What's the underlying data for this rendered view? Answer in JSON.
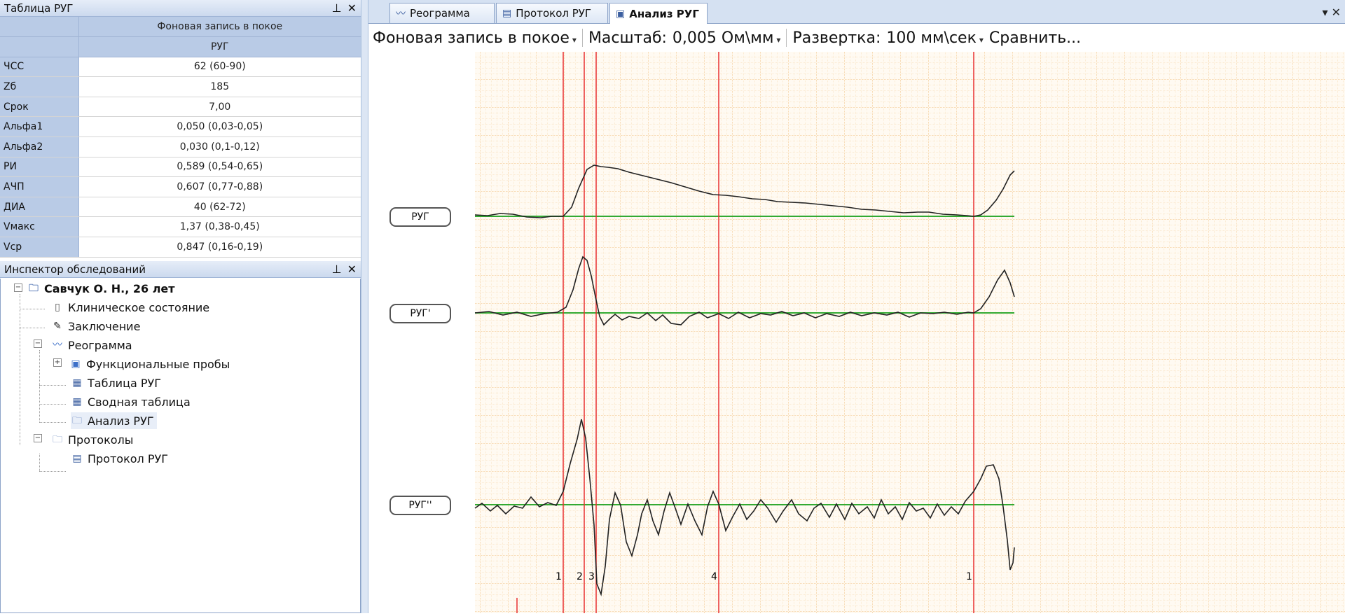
{
  "table_panel": {
    "title": "Таблица РУГ",
    "header_top": "Фоновая запись в покое",
    "header_sub": "РУГ",
    "rows": [
      {
        "label": "ЧСС",
        "value": "62 (60-90)"
      },
      {
        "label": "Zб",
        "value": "185"
      },
      {
        "label": "Срок",
        "value": "7,00"
      },
      {
        "label": "Альфа1",
        "value": "0,050 (0,03-0,05)"
      },
      {
        "label": "Альфа2",
        "value": "0,030 (0,1-0,12)"
      },
      {
        "label": "РИ",
        "value": "0,589 (0,54-0,65)"
      },
      {
        "label": "АЧП",
        "value": "0,607 (0,77-0,88)"
      },
      {
        "label": "ДИА",
        "value": "40 (62-72)"
      },
      {
        "label": "Vмакс",
        "value": "1,37 (0,38-0,45)"
      },
      {
        "label": "Vср",
        "value": "0,847 (0,16-0,19)"
      }
    ]
  },
  "inspector": {
    "title": "Инспектор обследований",
    "patient": "Савчук О. Н., 26 лет",
    "clinical": "Клиническое состояние",
    "conclusion": "Заключение",
    "reogram": "Реограмма",
    "func_tests": "Функциональные пробы",
    "table_rug": "Таблица РУГ",
    "summary": "Сводная таблица",
    "analysis": "Анализ РУГ",
    "protocols": "Протоколы",
    "protocol_rug": "Протокол РУГ"
  },
  "tabs": [
    {
      "label": "Реограмма"
    },
    {
      "label": "Протокол РУГ"
    },
    {
      "label": "Анализ РУГ"
    }
  ],
  "toolbar": {
    "record": "Фоновая запись в покое",
    "scale_label": "Масштаб:",
    "scale_value": "0,005 Ом\\мм",
    "sweep_label": "Развертка:",
    "sweep_value": "100 мм\\сек",
    "compare": "Сравнить..."
  },
  "channels": [
    {
      "label": "РУГ"
    },
    {
      "label": "РУГ'"
    },
    {
      "label": "РУГ''"
    }
  ],
  "markers": [
    "1",
    "2",
    "3",
    "4",
    "1"
  ],
  "colors": {
    "grid_major": "#f0c080",
    "grid_minor": "#f7dcb4",
    "baseline": "#33aa33",
    "marker": "#e83030",
    "trace": "#222222",
    "header_bg": "#b9cbe6"
  }
}
